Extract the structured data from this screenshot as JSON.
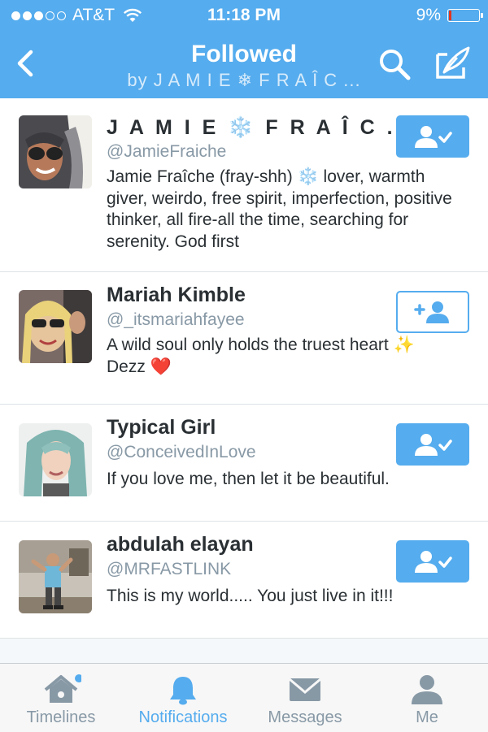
{
  "status_bar": {
    "carrier": "AT&T",
    "signal_bars": 3,
    "time": "11:18 PM",
    "battery_percent": "9%",
    "battery_level": 0.09
  },
  "nav": {
    "title": "Followed",
    "subtitle": "by J A M I E ❄ F R A Î C ...",
    "back_icon": "chevron-left-icon",
    "search_icon": "search-icon",
    "compose_icon": "compose-icon"
  },
  "users": [
    {
      "name": "J A M I E ❄️ F R A Î C ...",
      "handle": "@JamieFraiche",
      "bio": "Jamie Fraîche (fray-shh) ❄️ lover, warmth giver, weirdo, free spirit, imperfection, positive thinker, all fire-all the time, searching for serenity. God first",
      "following": true
    },
    {
      "name": "Mariah Kimble",
      "handle": "@_itsmariahfayee",
      "bio": "A wild soul only holds the truest heart ✨ Dezz ❤️",
      "following": false
    },
    {
      "name": "Typical Girl",
      "handle": "@ConceivedInLove",
      "bio": "If you love me, then let it be beautiful.",
      "following": true
    },
    {
      "name": "abdulah elayan",
      "handle": "@MRFASTLINK",
      "bio": "This is my world..... You just live in it!!!",
      "following": true
    }
  ],
  "tabs": [
    {
      "label": "Timelines",
      "icon": "home-icon",
      "active": false,
      "has_dot": true
    },
    {
      "label": "Notifications",
      "icon": "bell-icon",
      "active": true
    },
    {
      "label": "Messages",
      "icon": "envelope-icon",
      "active": false
    },
    {
      "label": "Me",
      "icon": "person-icon",
      "active": false
    }
  ],
  "colors": {
    "accent": "#55acee",
    "text": "#292f33",
    "secondary_text": "#8899a6",
    "battery_low": "#e0361f"
  }
}
